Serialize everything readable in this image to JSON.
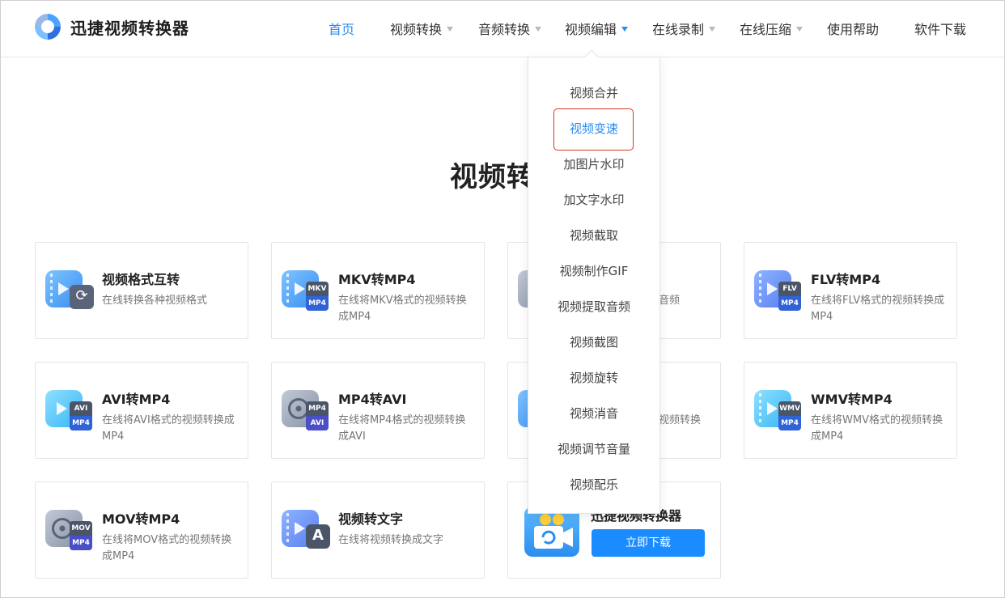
{
  "header": {
    "brand": "迅捷视频转换器",
    "nav": [
      {
        "label": "首页",
        "active": true,
        "caret": false
      },
      {
        "label": "视频转换",
        "active": false,
        "caret": true
      },
      {
        "label": "音频转换",
        "active": false,
        "caret": true
      },
      {
        "label": "视频编辑",
        "active": false,
        "caret": true,
        "caret_color": "#2a8cf0"
      },
      {
        "label": "在线录制",
        "active": false,
        "caret": true
      },
      {
        "label": "在线压缩",
        "active": false,
        "caret": true
      },
      {
        "label": "使用帮助",
        "active": false,
        "caret": false
      },
      {
        "label": "软件下载",
        "active": false,
        "caret": false
      }
    ]
  },
  "page_title": "视频转",
  "cards": [
    {
      "title": "视频格式互转",
      "desc": "在线转换各种视频格式",
      "icon": "format-convert-icon"
    },
    {
      "title": "MKV转MP4",
      "desc": "在线将MKV格式的视频转换成MP4",
      "badge_top": "MKV",
      "badge_bottom": "MP4"
    },
    {
      "title": "",
      "desc": "音频",
      "icon": "video-to-audio-icon"
    },
    {
      "title": "FLV转MP4",
      "desc": "在线将FLV格式的视频转换成MP4",
      "badge_top": "FLV",
      "badge_bottom": "MP4"
    },
    {
      "title": "AVI转MP4",
      "desc": "在线将AVI格式的视频转换成MP4",
      "badge_top": "AVI",
      "badge_bottom": "MP4"
    },
    {
      "title": "MP4转AVI",
      "desc": "在线将MP4格式的视频转换成AVI",
      "badge_top": "MP4",
      "badge_bottom": "AVI"
    },
    {
      "title": "",
      "desc": "视频转换",
      "icon": "video-convert-icon"
    },
    {
      "title": "WMV转MP4",
      "desc": "在线将WMV格式的视频转换成MP4",
      "badge_top": "WMV",
      "badge_bottom": "MP4"
    },
    {
      "title": "MOV转MP4",
      "desc": "在线将MOV格式的视频转换成MP4",
      "badge_top": "MOV",
      "badge_bottom": "MP4"
    },
    {
      "title": "视频转文字",
      "desc": "在线将视频转换成文字",
      "icon": "video-to-text-icon"
    }
  ],
  "download": {
    "title": "迅捷视频转换器",
    "button": "立即下载"
  },
  "dropdown": {
    "items": [
      "视频合并",
      "视频变速",
      "加图片水印",
      "加文字水印",
      "视频截取",
      "视频制作GIF",
      "视频提取音频",
      "视频截图",
      "视频旋转",
      "视频消音",
      "视频调节音量",
      "视频配乐"
    ],
    "highlighted": "视频变速"
  },
  "colors": {
    "accent": "#2a8cf0",
    "button": "#1a8cff",
    "focus_outline": "#d23a2a"
  }
}
